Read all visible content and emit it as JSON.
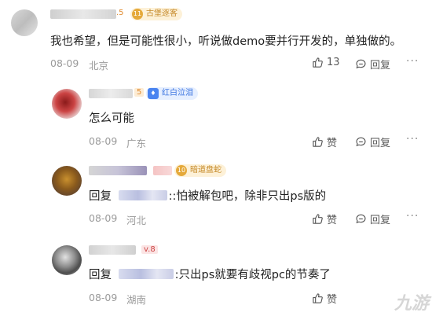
{
  "comments": [
    {
      "level": ".5",
      "badge": {
        "icon": "11",
        "text": "古堡逐客"
      },
      "text": "我也希望，但是可能性很小，听说做demo要并行开发的，单独做的。",
      "date": "08-09",
      "location": "北京",
      "likes": "13",
      "reply_label": "回复"
    },
    {
      "level": "5",
      "badge": {
        "icon": "",
        "text": "红白泣泪"
      },
      "text": "怎么可能",
      "date": "08-09",
      "location": "广东",
      "likes": "赞",
      "reply_label": "回复"
    },
    {
      "level": "",
      "badge": {
        "icon": "10",
        "text": "暗道盘蛇"
      },
      "reply_prefix": "回复",
      "text": "::怕被解包吧，除非只出ps版的",
      "date": "08-09",
      "location": "河北",
      "likes": "赞",
      "reply_label": "回复"
    },
    {
      "level": "v.8",
      "badge": null,
      "reply_prefix": "回复",
      "text": ":只出ps就要有歧视pc的节奏了",
      "date": "08-09",
      "location": "湖南",
      "likes": "赞",
      "reply_label": "回复"
    }
  ],
  "more_label": "···",
  "watermark": "九游",
  "colors": {
    "badge_gold_bg": "#fdf1d8",
    "badge_gold_text": "#c68a2a",
    "badge_blue_bg": "#e6efff",
    "badge_blue_text": "#3b74e0"
  }
}
